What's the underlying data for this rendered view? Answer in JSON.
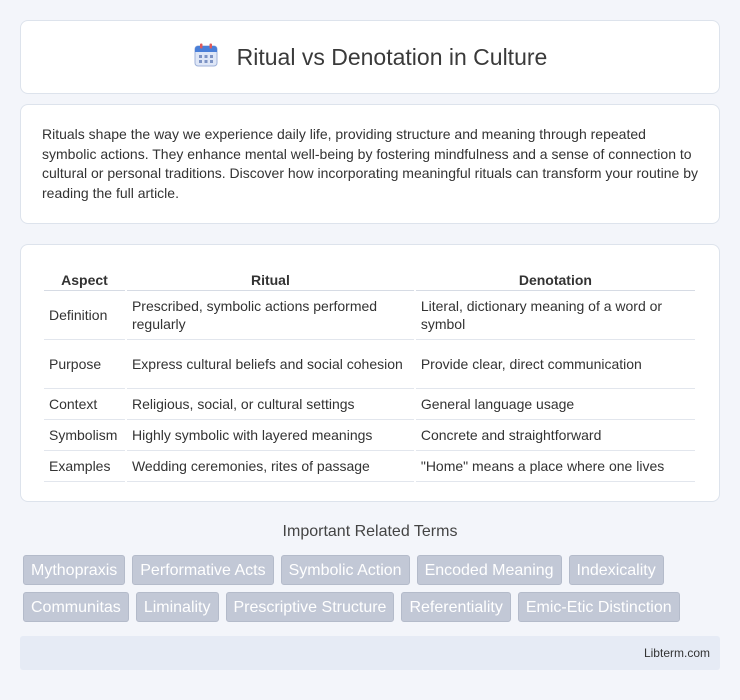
{
  "header": {
    "title": "Ritual vs Denotation in Culture",
    "icon": "calendar-icon"
  },
  "intro": {
    "text": "Rituals shape the way we experience daily life, providing structure and meaning through repeated symbolic actions. They enhance mental well-being by fostering mindfulness and a sense of connection to cultural or personal traditions. Discover how incorporating meaningful rituals can transform your routine by reading the full article."
  },
  "table": {
    "headers": [
      "Aspect",
      "Ritual",
      "Denotation"
    ],
    "rows": [
      [
        "Definition",
        "Prescribed, symbolic actions performed regularly",
        "Literal, dictionary meaning of a word or symbol"
      ],
      [
        "Purpose",
        "Express cultural beliefs and social cohesion",
        "Provide clear, direct communication"
      ],
      [
        "Context",
        "Religious, social, or cultural settings",
        "General language usage"
      ],
      [
        "Symbolism",
        "Highly symbolic with layered meanings",
        "Concrete and straightforward"
      ],
      [
        "Examples",
        "Wedding ceremonies, rites of passage",
        "\"Home\" means a place where one lives"
      ]
    ]
  },
  "related": {
    "title": "Important Related Terms",
    "row1": [
      "Mythopraxis",
      "Performative Acts",
      "Symbolic Action",
      "Encoded Meaning",
      "Indexicality"
    ],
    "row2": [
      "Communitas",
      "Liminality",
      "Prescriptive Structure",
      "Referentiality",
      "Emic-Etic Distinction"
    ]
  },
  "footer": {
    "site": "Libterm.com"
  },
  "colors": {
    "background": "#f3f5fa",
    "tag_bg": "#c2c8d6",
    "footer_bg": "#e6ebf5",
    "icon_blue": "#4a7fd8"
  }
}
